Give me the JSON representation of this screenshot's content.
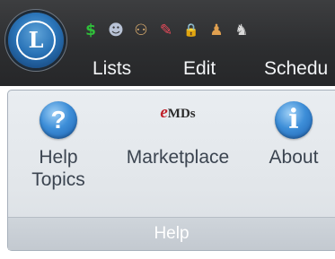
{
  "app": {
    "orb_letter": "L"
  },
  "quick_access": {
    "items": [
      {
        "icon": "dollar-icon",
        "glyph": "$",
        "color": "#2fbf3a"
      },
      {
        "icon": "person-icon",
        "glyph": "☻",
        "color": "#b9c3d6"
      },
      {
        "icon": "people-icon",
        "glyph": "⚇",
        "color": "#e0b070"
      },
      {
        "icon": "schedule-icon",
        "glyph": "✎",
        "color": "#e84a5a"
      },
      {
        "icon": "lock-icon",
        "glyph": "🔒",
        "color": "#e6b830"
      },
      {
        "icon": "user-icon",
        "glyph": "♟",
        "color": "#e0a050"
      },
      {
        "icon": "user-search-icon",
        "glyph": "♞",
        "color": "#d8d8d8"
      }
    ]
  },
  "menu": {
    "items": [
      {
        "label": "Lists"
      },
      {
        "label": "Edit"
      },
      {
        "label": "Schedu"
      }
    ]
  },
  "ribbon": {
    "group_label": "Help",
    "buttons": {
      "help_topics": {
        "line1": "Help",
        "line2": "Topics",
        "icon_glyph": "?"
      },
      "marketplace": {
        "label": "Marketplace",
        "logo_e": "e",
        "logo_text": "MDs"
      },
      "about": {
        "label": "About",
        "icon_glyph": "i"
      }
    }
  }
}
